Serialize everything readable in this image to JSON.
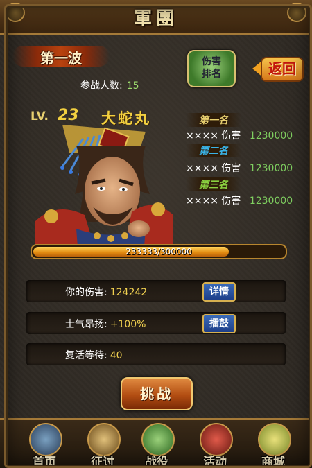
{
  "header": {
    "title": "軍團"
  },
  "wave": {
    "label": "第一波"
  },
  "participants": {
    "label": "参战人数:",
    "value": "15"
  },
  "rank_button": {
    "line1": "伤害",
    "line2": "排名"
  },
  "back_button": {
    "label": "返回"
  },
  "boss": {
    "lv_label": "LV.",
    "level": "23",
    "name": "大蛇丸"
  },
  "ranking": [
    {
      "title": "第一名",
      "player": "××××",
      "dmg_label": "伤害",
      "dmg_value": "1230000"
    },
    {
      "title": "第二名",
      "player": "××××",
      "dmg_label": "伤害",
      "dmg_value": "1230000"
    },
    {
      "title": "第三名",
      "player": "××××",
      "dmg_label": "伤害",
      "dmg_value": "1230000"
    }
  ],
  "hp": {
    "text": "233333/300000",
    "fraction": 0.778
  },
  "stats": [
    {
      "label": "你的伤害:",
      "value": "124242",
      "button": "详情"
    },
    {
      "label": "士气昂扬:",
      "value": "+100%",
      "button": "擂鼓"
    },
    {
      "label": "复活等待:",
      "value": "40"
    }
  ],
  "challenge_button": {
    "label": "挑战"
  },
  "nav": [
    {
      "label": "首页",
      "icon": "home-icon"
    },
    {
      "label": "征讨",
      "icon": "sword-icon"
    },
    {
      "label": "战役",
      "icon": "scroll-icon"
    },
    {
      "label": "活动",
      "icon": "drum-icon"
    },
    {
      "label": "商城",
      "icon": "shop-icon"
    }
  ],
  "colors": {
    "gold": "#f2d040",
    "green": "#7fd060",
    "frame": "#a57a38"
  }
}
